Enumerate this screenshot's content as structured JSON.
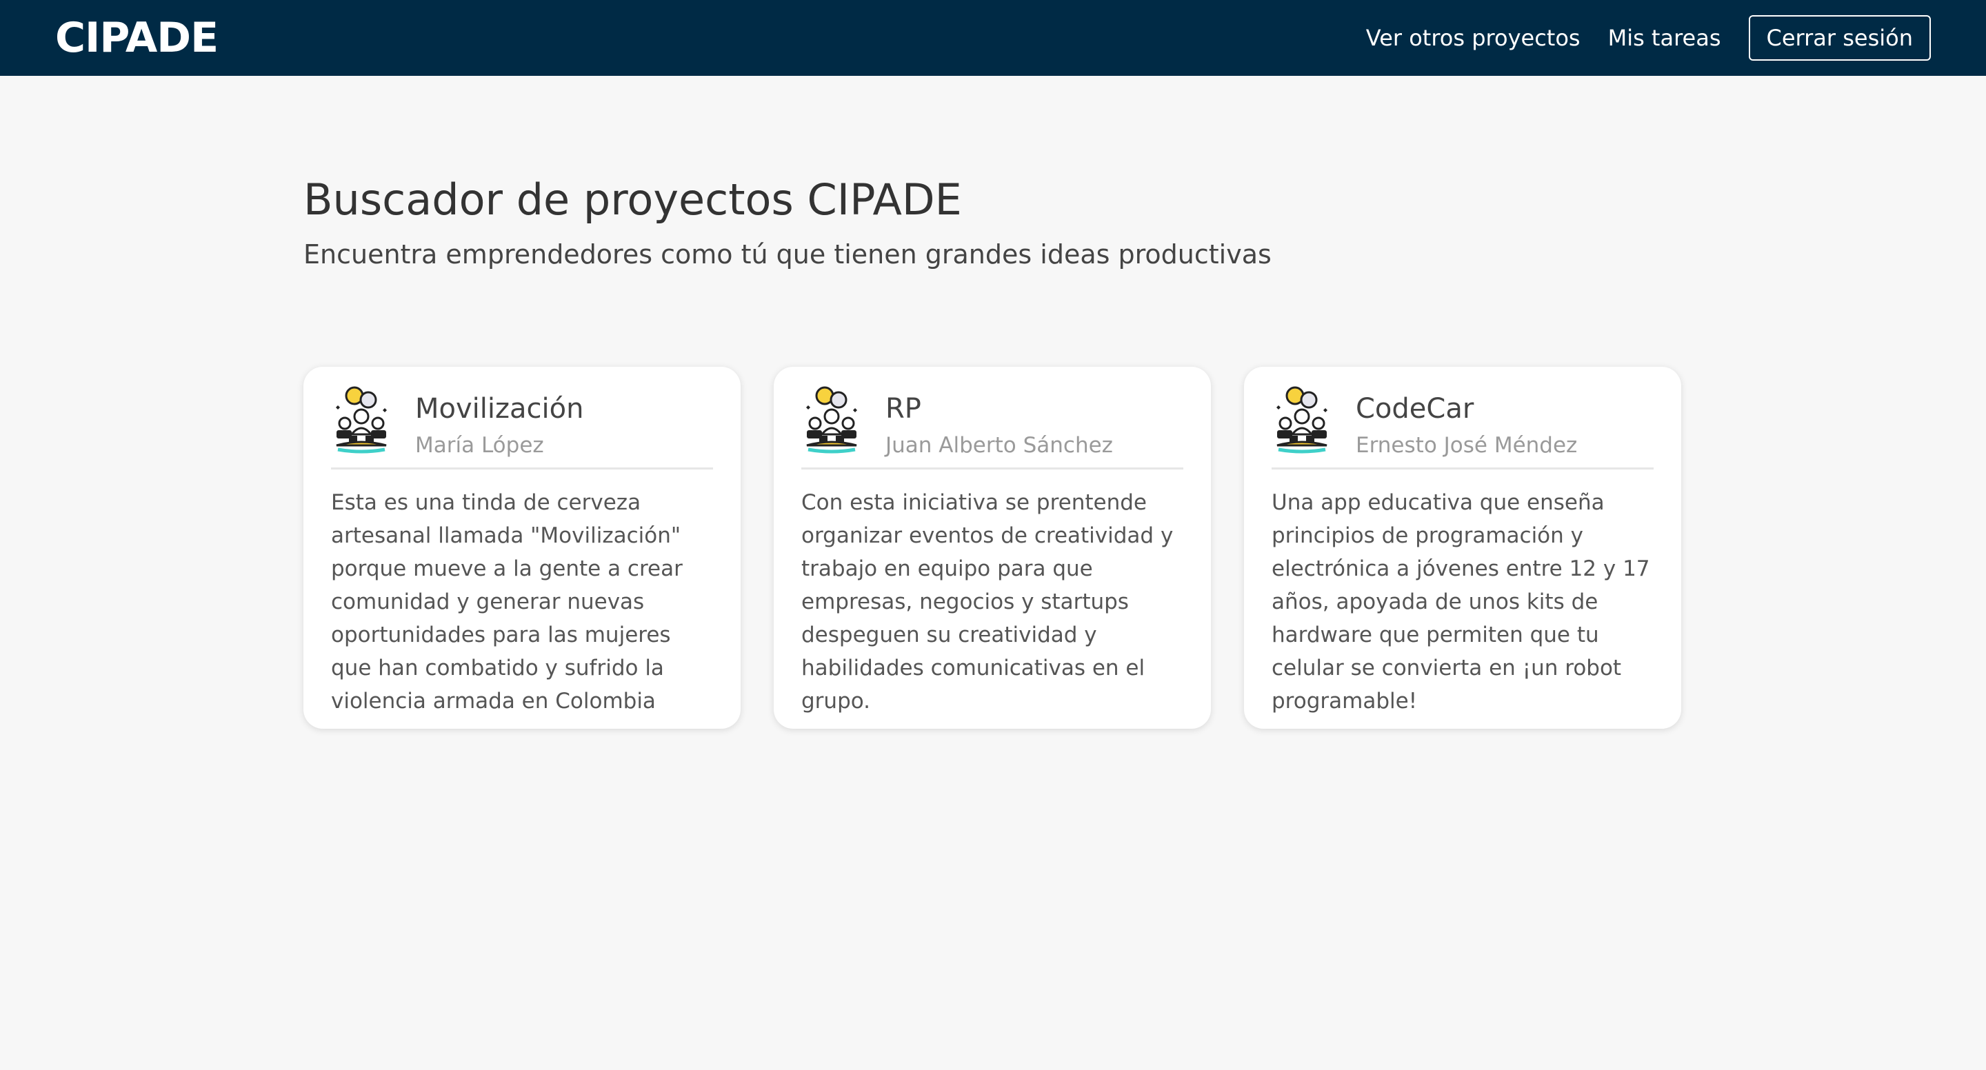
{
  "navbar": {
    "brand": "CIPADE",
    "links": [
      {
        "label": "Ver otros proyectos"
      },
      {
        "label": "Mis tareas"
      }
    ],
    "logout_label": "Cerrar sesión",
    "background": "#002a45"
  },
  "hero": {
    "title": "Buscador de proyectos CIPADE",
    "subtitle": "Encuentra emprendedores como tú que tienen grandes ideas productivas"
  },
  "projects": [
    {
      "icon": "team-ideas-icon",
      "title": "Movilización",
      "author": "María López",
      "description": "Esta es una tinda de cerveza artesanal llamada \"Movilización\" porque mueve a la gente a crear comunidad y generar nuevas oportunidades para las mujeres que han combatido y sufrido la violencia armada en Colombia"
    },
    {
      "icon": "team-ideas-icon",
      "title": "RP",
      "author": "Juan Alberto Sánchez",
      "description": "Con esta iniciativa se prentende organizar eventos de creatividad y trabajo en equipo para que empresas, negocios y startups despeguen su creatividad y habilidades comunicativas en el grupo."
    },
    {
      "icon": "team-ideas-icon",
      "title": "CodeCar",
      "author": "Ernesto José Méndez",
      "description": "Una app educativa que enseña principios de programación y electrónica a jóvenes entre 12 y 17 años, apoyada de unos kits de hardware que permiten que tu celular se convierta en ¡un robot programable!"
    }
  ]
}
